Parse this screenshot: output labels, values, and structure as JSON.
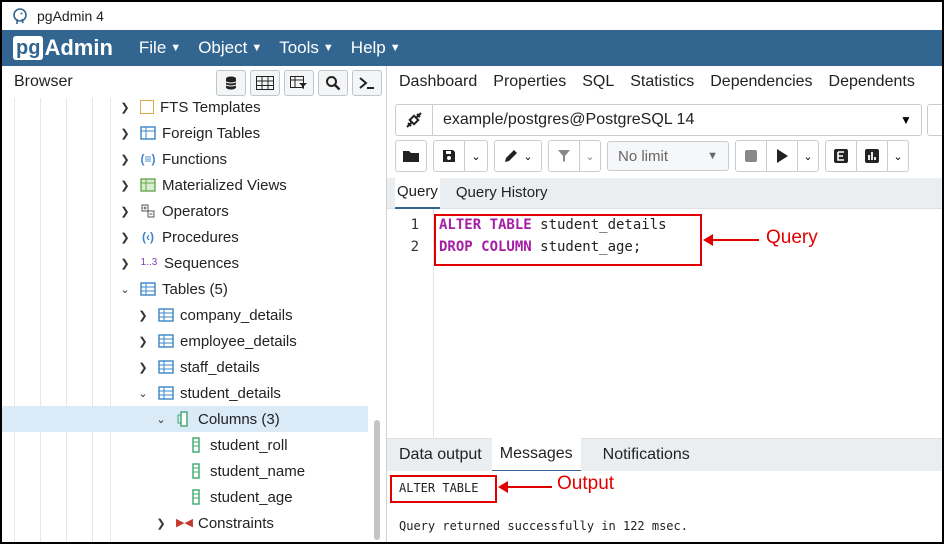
{
  "window": {
    "title": "pgAdmin 4"
  },
  "menubar": {
    "logo_pg": "pg",
    "logo_admin": "Admin",
    "items": [
      "File",
      "Object",
      "Tools",
      "Help"
    ]
  },
  "browser": {
    "label": "Browser"
  },
  "tree": [
    {
      "label": "FTS Templates",
      "icon": "fts-templates-icon",
      "expanded": false
    },
    {
      "label": "Foreign Tables",
      "icon": "foreign-tables-icon",
      "expanded": false
    },
    {
      "label": "Functions",
      "icon": "functions-icon",
      "expanded": false
    },
    {
      "label": "Materialized Views",
      "icon": "materialized-views-icon",
      "expanded": false
    },
    {
      "label": "Operators",
      "icon": "operators-icon",
      "expanded": false
    },
    {
      "label": "Procedures",
      "icon": "procedures-icon",
      "expanded": false
    },
    {
      "label": "Sequences",
      "icon": "sequences-icon",
      "expanded": false,
      "glyph": "1..3"
    },
    {
      "label": "Tables (5)",
      "icon": "tables-icon",
      "expanded": true
    },
    {
      "label": "company_details",
      "icon": "table-icon",
      "expanded": false
    },
    {
      "label": "employee_details",
      "icon": "table-icon",
      "expanded": false
    },
    {
      "label": "staff_details",
      "icon": "table-icon",
      "expanded": false
    },
    {
      "label": "student_details",
      "icon": "table-icon",
      "expanded": true
    },
    {
      "label": "Columns (3)",
      "icon": "columns-icon",
      "expanded": true,
      "selected": true
    },
    {
      "label": "student_roll",
      "icon": "column-icon"
    },
    {
      "label": "student_name",
      "icon": "column-icon"
    },
    {
      "label": "student_age",
      "icon": "column-icon"
    },
    {
      "label": "Constraints",
      "icon": "constraints-icon",
      "expanded": false
    }
  ],
  "top_tabs": [
    "Dashboard",
    "Properties",
    "SQL",
    "Statistics",
    "Dependencies",
    "Dependents"
  ],
  "connection": {
    "value": "example/postgres@PostgreSQL 14"
  },
  "toolbar": {
    "limit": "No limit"
  },
  "query_tabs": [
    "Query",
    "Query History"
  ],
  "editor": {
    "line_numbers": [
      "1",
      "2"
    ],
    "lines": [
      {
        "kw": "ALTER TABLE",
        "rest": " student_details"
      },
      {
        "kw": "DROP COLUMN",
        "rest": " student_age;"
      }
    ]
  },
  "annotations": {
    "query": "Query",
    "output": "Output"
  },
  "output_tabs": [
    "Data output",
    "Messages",
    "Notifications"
  ],
  "output": {
    "result": "ALTER TABLE",
    "message": "Query returned successfully in 122 msec."
  },
  "colors": {
    "menubar": "#326690",
    "keyword": "#a51ea5",
    "annotation": "#e00000",
    "selected_row": "#dbeaf7"
  }
}
